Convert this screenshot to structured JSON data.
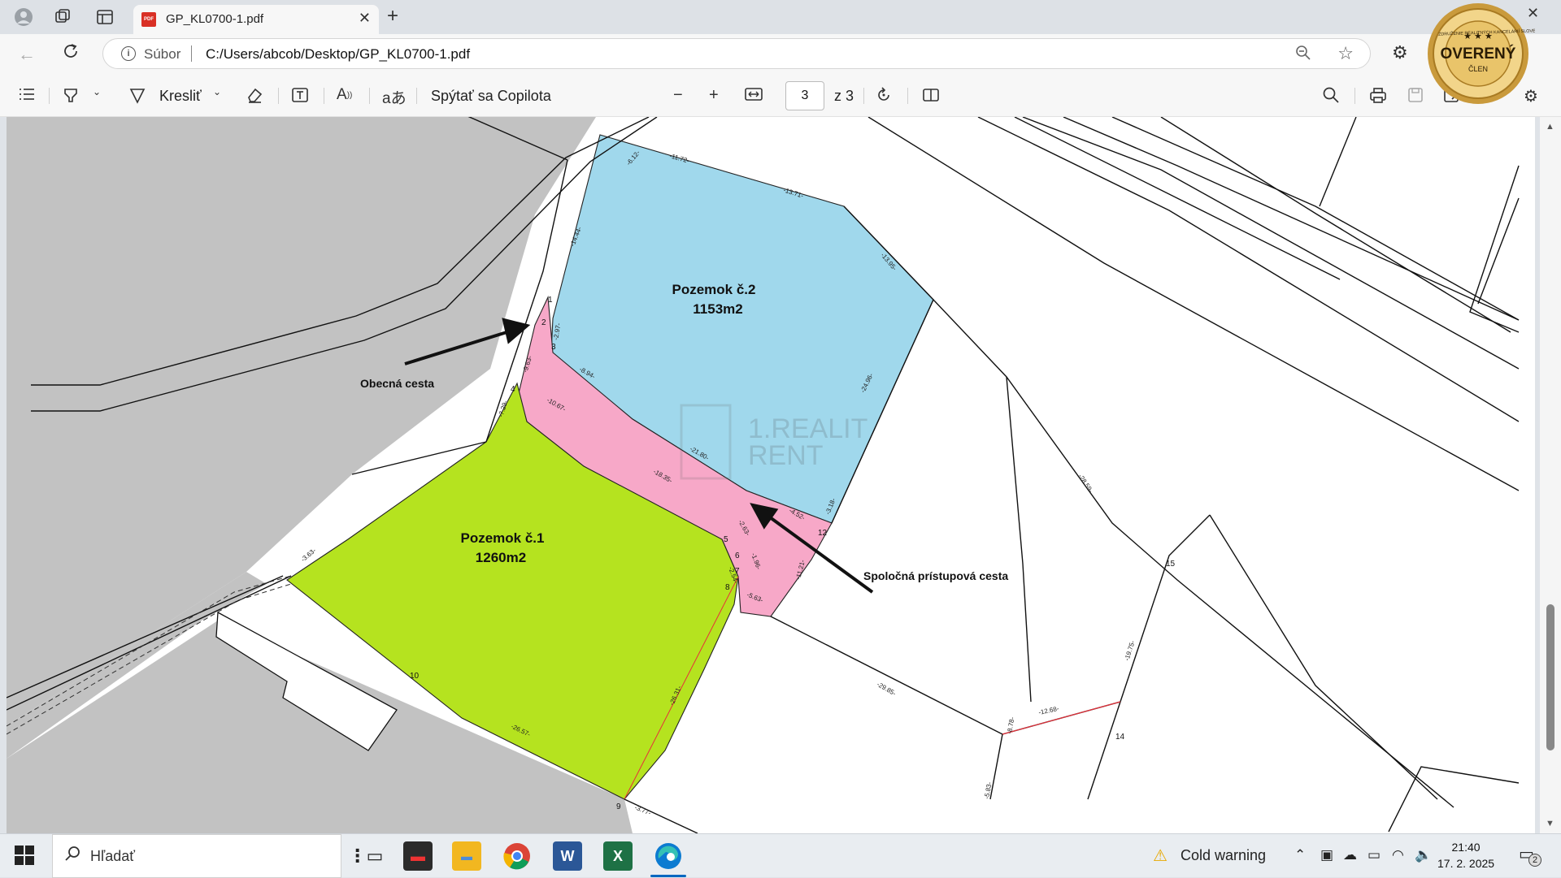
{
  "browser": {
    "tab_title": "GP_KL0700-1.pdf",
    "address_scheme": "Súbor",
    "address_url": "C:/Users/abcob/Desktop/GP_KL0700-1.pdf"
  },
  "pdf_toolbar": {
    "draw_label": "Kresliť",
    "copilot_label": "Spýtať sa Copilota",
    "page_current": "3",
    "page_total": "z 3"
  },
  "badge": {
    "main": "OVERENÝ",
    "sub": "ČLEN",
    "ring": "ZDRUŽENIE REALITNÝCH KANCELÁRIÍ SLOVENSKA"
  },
  "map": {
    "parcel1_title": "Pozemok č.1",
    "parcel1_area": "1260m2",
    "parcel2_title": "Pozemok č.2",
    "parcel2_area": "1153m2",
    "label_road": "Obecná cesta",
    "label_access": "Spoločná prístupová cesta",
    "watermark_line1": "1.REALIT",
    "watermark_line2": "RENT",
    "points": [
      "1",
      "2",
      "3",
      "4",
      "5",
      "6",
      "7",
      "8",
      "9",
      "10",
      "12",
      "14",
      "15"
    ],
    "dims": [
      "-11.72-",
      "-13.71-",
      "-13.95-",
      "-24.96-",
      "-14.44-",
      "-2.97-",
      "-9.63-",
      "-8.94-",
      "-10.67-",
      "-21.80-",
      "-18.35-",
      "-7.29-",
      "-4.52-",
      "-3.18-",
      "-2.63-",
      "-1.96-",
      "-5.63-",
      "-11.21-",
      "-2.54-",
      "-26.31-",
      "-26.57-",
      "-3.77-",
      "-3.63-",
      "-29.85-",
      "-28.59-",
      "-19.75-",
      "-12.68-",
      "-5.83-",
      "-8.78-",
      "-6.12-"
    ],
    "colors": {
      "parcel1": "#b5e31f",
      "parcel2": "#a0d8ec",
      "access": "#f7a8c8",
      "road": "#c2c2c2"
    }
  },
  "taskbar": {
    "search_placeholder": "Hľadať",
    "weather": "Cold warning",
    "time": "21:40",
    "date": "17. 2. 2025",
    "notif_count": "2"
  }
}
